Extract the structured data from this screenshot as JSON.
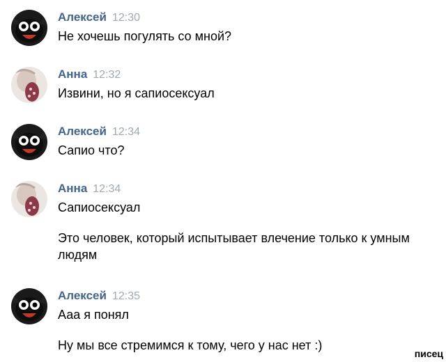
{
  "messages": [
    {
      "author": "Алексей",
      "time": "12:30",
      "avatar": "cat-avatar-icon",
      "texts": [
        "Не хочешь погулять со мной?"
      ]
    },
    {
      "author": "Анна",
      "time": "12:32",
      "avatar": "girl-avatar-icon",
      "texts": [
        "Извини, но я сапиосексуал"
      ]
    },
    {
      "author": "Алексей",
      "time": "12:34",
      "avatar": "cat-avatar-icon",
      "texts": [
        "Сапио что?"
      ]
    },
    {
      "author": "Анна",
      "time": "12:34",
      "avatar": "girl-avatar-icon",
      "texts": [
        "Сапиосексуал",
        "Это человек, который испытывает влечение только к умным людям"
      ]
    },
    {
      "author": "Алексей",
      "time": "12:35",
      "avatar": "cat-avatar-icon",
      "texts": [
        "Ааа я понял",
        "Ну мы все стремимся к тому, чего у нас нет :)"
      ]
    }
  ],
  "watermark": "писец",
  "colors": {
    "author": "#42648b",
    "time": "#a0a8b0",
    "text": "#000000"
  }
}
